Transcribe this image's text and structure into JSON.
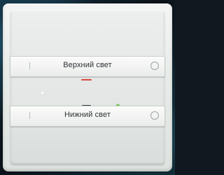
{
  "switch": {
    "top_button": {
      "label": "Верхний свет",
      "indicator_color": "#d64b3f"
    },
    "bottom_button": {
      "label": "Нижний свет",
      "indicator_color": "#3b4044"
    },
    "status_led_color": "#56b53e",
    "icons": {
      "left_mark": "vertical-line",
      "right_mark": "circle-outline"
    }
  }
}
